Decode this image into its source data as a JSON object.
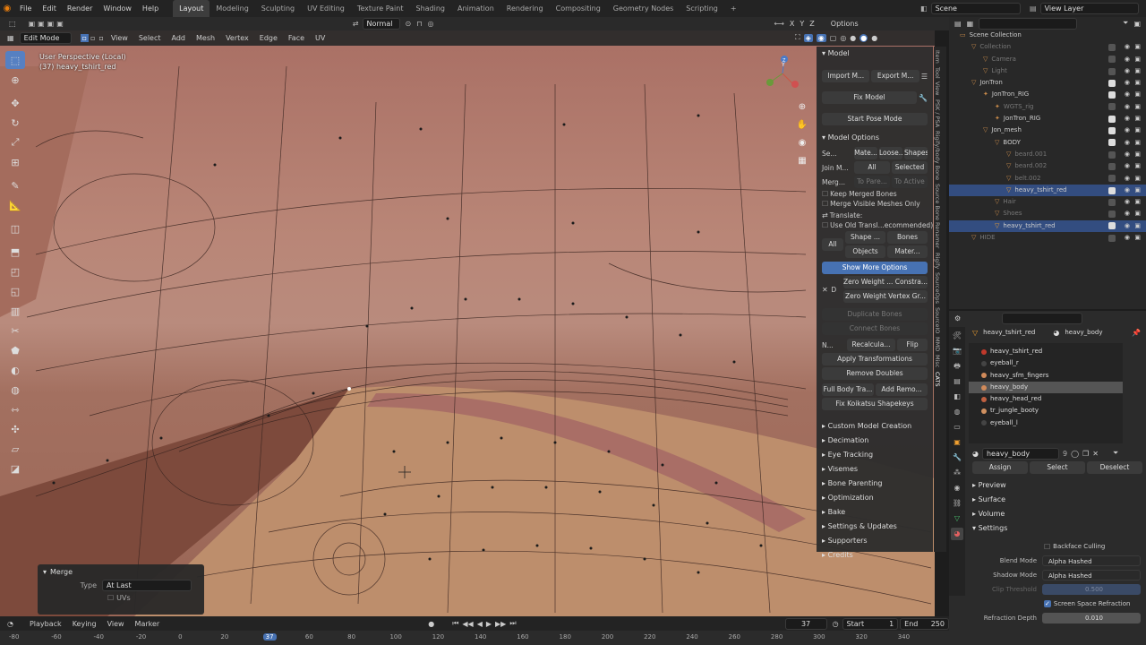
{
  "topbar": {
    "menus": [
      "File",
      "Edit",
      "Render",
      "Window",
      "Help"
    ],
    "workspaces": [
      "Layout",
      "Modeling",
      "Sculpting",
      "UV Editing",
      "Texture Paint",
      "Shading",
      "Animation",
      "Rendering",
      "Compositing",
      "Geometry Nodes",
      "Scripting"
    ],
    "active_workspace": "Layout",
    "add_tab": "+",
    "scene": "Scene",
    "view_layer": "View Layer",
    "orientation": "Normal",
    "options": "Options",
    "axes": [
      "X",
      "Y",
      "Z"
    ]
  },
  "viewport_header": {
    "mode": "Edit Mode",
    "menus": [
      "View",
      "Select",
      "Add",
      "Mesh",
      "Vertex",
      "Edge",
      "Face",
      "UV"
    ]
  },
  "viewport": {
    "perspective": "User Perspective (Local)",
    "object": "(37) heavy_tshirt_red",
    "gizmo_labels": [
      "Y",
      "Z"
    ]
  },
  "npanel": {
    "model_header": "Model",
    "import_btn": "Import M...",
    "export_btn": "Export M...",
    "fix_model": "Fix Model",
    "start_pose": "Start Pose Mode",
    "model_options": "Model Options",
    "sep_label": "Se...",
    "sep_opts": [
      "Mate...",
      "Loose...",
      "Shapes"
    ],
    "join_label": "Join M...",
    "join_opts": [
      "All",
      "Selected"
    ],
    "merge_label": "Merg...",
    "merge_opts": [
      "To Pare...",
      "To Active"
    ],
    "keep_merged": "Keep Merged Bones",
    "merge_visible": "Merge Visible Meshes Only",
    "translate": "Translate:",
    "use_old": "Use Old Transl...ecommended)",
    "all_label": "All",
    "trans_opts1": [
      "Shape ...",
      "Bones"
    ],
    "trans_opts2": [
      "Objects",
      "Mater..."
    ],
    "show_more": "Show More Options",
    "x_label": "D",
    "zero_weight": "Zero Weight ... Constra...",
    "zero_weight2": "Zero Weight Vertex Gr...",
    "dup_bones": "Duplicate Bones",
    "conn_bones": "Connect Bones",
    "n_label": "N...",
    "recalc": "Recalcula...",
    "flip": "Flip",
    "apply_trans": "Apply Transformations",
    "remove_doubles": "Remove Doubles",
    "full_body": "Full Body Tra...",
    "add_remo": "Add Remo...",
    "fix_koi": "Fix Koikatsu Shapekeys",
    "sections": [
      "Custom Model Creation",
      "Decimation",
      "Eye Tracking",
      "Visemes",
      "Bone Parenting",
      "Optimization",
      "Bake",
      "Settings & Updates",
      "Supporters",
      "Credits"
    ],
    "tabs": [
      "Item",
      "Tool",
      "View",
      "PSK / PSA",
      "Rigify/body Bone",
      "Source Bone Renamer",
      "Rigify",
      "SourceOps",
      "SourceIO",
      "MMD",
      "Misc",
      "CATS"
    ]
  },
  "outliner": {
    "search": "",
    "rows": [
      {
        "label": "Scene Collection",
        "indent": 0,
        "state": "normal"
      },
      {
        "label": "Collection",
        "indent": 1,
        "state": "dim"
      },
      {
        "label": "Camera",
        "indent": 2,
        "state": "dim"
      },
      {
        "label": "Light",
        "indent": 2,
        "state": "dim"
      },
      {
        "label": "JonTron",
        "indent": 1,
        "state": "normal"
      },
      {
        "label": "JonTron_RIG",
        "indent": 2,
        "state": "normal"
      },
      {
        "label": "WGTS_rig",
        "indent": 3,
        "state": "dim"
      },
      {
        "label": "JonTron_RIG",
        "indent": 3,
        "state": "normal"
      },
      {
        "label": "Jon_mesh",
        "indent": 2,
        "state": "normal"
      },
      {
        "label": "BODY",
        "indent": 3,
        "state": "normal"
      },
      {
        "label": "beard.001",
        "indent": 4,
        "state": "dim"
      },
      {
        "label": "beard.002",
        "indent": 4,
        "state": "dim"
      },
      {
        "label": "belt.002",
        "indent": 4,
        "state": "dim"
      },
      {
        "label": "heavy_tshirt_red",
        "indent": 4,
        "state": "sel"
      },
      {
        "label": "Hair",
        "indent": 3,
        "state": "dim"
      },
      {
        "label": "Shoes",
        "indent": 3,
        "state": "dim"
      },
      {
        "label": "heavy_tshirt_red",
        "indent": 3,
        "state": "sel"
      },
      {
        "label": "HIDE",
        "indent": 1,
        "state": "dim"
      }
    ]
  },
  "properties": {
    "object_name": "heavy_tshirt_red",
    "data_name": "heavy_body",
    "slots": [
      {
        "name": "heavy_tshirt_red",
        "color": "#c0392b"
      },
      {
        "name": "eyeball_r",
        "color": "#444"
      },
      {
        "name": "heavy_sfm_fingers",
        "color": "#d08a5a"
      },
      {
        "name": "heavy_body",
        "color": "#d08a5a"
      },
      {
        "name": "heavy_head_red",
        "color": "#c06040"
      },
      {
        "name": "tr_jungle_booty",
        "color": "#d09060"
      },
      {
        "name": "eyeball_l",
        "color": "#444"
      }
    ],
    "active_slot": 3,
    "material": "heavy_body",
    "material_users": "9",
    "assign": "Assign",
    "select": "Select",
    "deselect": "Deselect",
    "sections": [
      "Preview",
      "Surface",
      "Volume",
      "Settings"
    ],
    "backface": "Backface Culling",
    "blend_label": "Blend Mode",
    "blend_val": "Alpha Hashed",
    "shadow_label": "Shadow Mode",
    "shadow_val": "Alpha Hashed",
    "clip_label": "Clip Threshold",
    "clip_val": "0.500",
    "ssr": "Screen Space Refraction",
    "refr_label": "Refraction Depth",
    "refr_val": "0.010"
  },
  "merge_popup": {
    "title": "Merge",
    "type_label": "Type",
    "type_value": "At Last",
    "uvs": "UVs"
  },
  "timeline": {
    "menus": [
      "Playback",
      "Keying",
      "View",
      "Marker"
    ],
    "current_frame": "37",
    "start_label": "Start",
    "start": "1",
    "end_label": "End",
    "end": "250",
    "ticks": [
      "-80",
      "-60",
      "-40",
      "-20",
      "0",
      "20",
      "37",
      "60",
      "80",
      "100",
      "120",
      "140",
      "160",
      "180",
      "200",
      "220",
      "240",
      "260",
      "280",
      "300",
      "320",
      "340"
    ]
  }
}
